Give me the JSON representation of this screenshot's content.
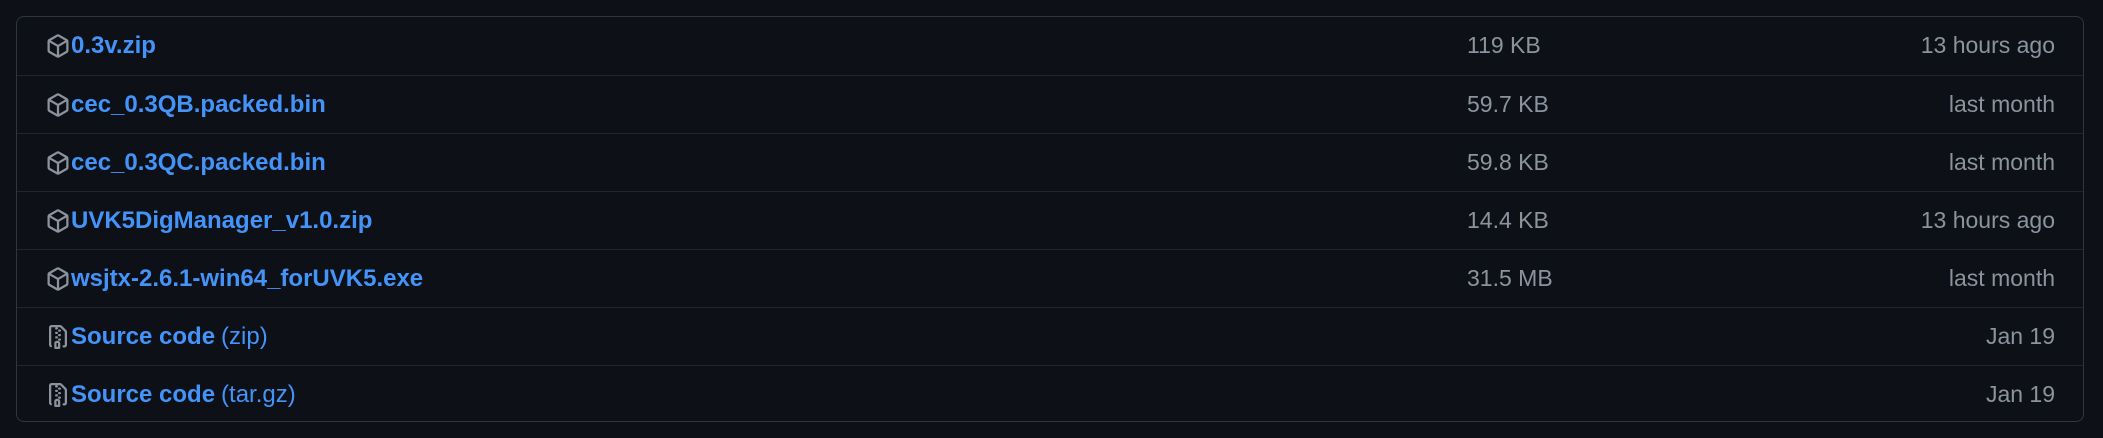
{
  "assets": [
    {
      "name": "0.3v.zip",
      "suffix": "",
      "size": "119 KB",
      "date": "13 hours ago",
      "icon": "package-icon"
    },
    {
      "name": "cec_0.3QB.packed.bin",
      "suffix": "",
      "size": "59.7 KB",
      "date": "last month",
      "icon": "package-icon"
    },
    {
      "name": "cec_0.3QC.packed.bin",
      "suffix": "",
      "size": "59.8 KB",
      "date": "last month",
      "icon": "package-icon"
    },
    {
      "name": "UVK5DigManager_v1.0.zip",
      "suffix": "",
      "size": "14.4 KB",
      "date": "13 hours ago",
      "icon": "package-icon"
    },
    {
      "name": "wsjtx-2.6.1-win64_forUVK5.exe",
      "suffix": "",
      "size": "31.5 MB",
      "date": "last month",
      "icon": "package-icon"
    },
    {
      "name": "Source code",
      "suffix": "(zip)",
      "size": "",
      "date": "Jan 19",
      "icon": "file-zip-icon"
    },
    {
      "name": "Source code",
      "suffix": "(tar.gz)",
      "size": "",
      "date": "Jan 19",
      "icon": "file-zip-icon"
    }
  ],
  "colors": {
    "background": "#0d1117",
    "border": "#30363d",
    "link": "#4493f8",
    "muted": "#8b949e"
  }
}
